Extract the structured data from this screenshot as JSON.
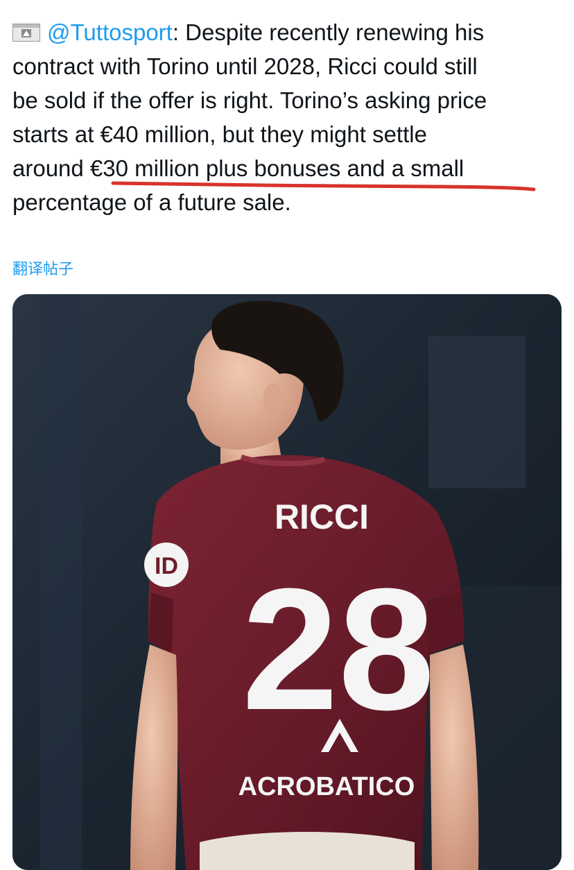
{
  "tweet": {
    "handle": "@Tuttosport",
    "text_lines": [
      ": Despite recently renewing his",
      "contract with Torino until 2028, Ricci could still",
      "be sold if the offer is right. Torino’s asking price",
      "starts at €40 million, but they might settle",
      "around €30 million plus bonuses and a small",
      "percentage of a future sale."
    ],
    "translate_label": "翻译帖子"
  },
  "photo": {
    "shirt_name": "RICCI",
    "shirt_number": "28",
    "sponsor": "ACROBATICO",
    "sleeve_badge": "ID"
  },
  "colors": {
    "link": "#1d9bf0",
    "underline": "#d8332b",
    "jersey": "#6e1d2a",
    "background": "#1a2430"
  },
  "icons": [
    "flag-icon"
  ]
}
